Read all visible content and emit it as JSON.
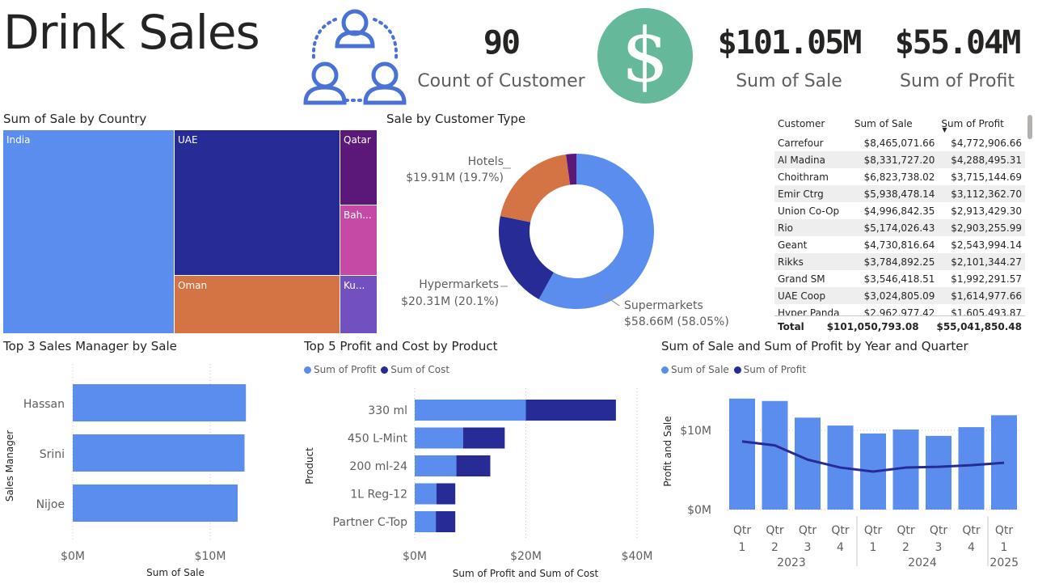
{
  "header": {
    "title": "Drink Sales",
    "customers_icon": "users-group-icon",
    "dollar_icon": "dollar-icon",
    "kpis": [
      {
        "value": "90",
        "label": "Count of Customer"
      },
      {
        "value": "$101.05M",
        "label": "Sum of Sale"
      },
      {
        "value": "$55.04M",
        "label": "Sum of Profit"
      }
    ],
    "dollar_symbol": "$"
  },
  "colors": {
    "blue": "#5b8def",
    "navy": "#262b96",
    "orange": "#d47444",
    "purple": "#5c1878",
    "pink": "#c54aa5",
    "violet": "#7350c0",
    "green": "#66b89a",
    "icon_blue": "#4a72d6"
  },
  "treemap": {
    "title": "Sum of Sale by Country",
    "cells": [
      {
        "label": "India",
        "color": "#5b8def"
      },
      {
        "label": "UAE",
        "color": "#262b96"
      },
      {
        "label": "Qatar",
        "color": "#5c1878"
      },
      {
        "label": "Bah...",
        "color": "#c54aa5"
      },
      {
        "label": "Oman",
        "color": "#d47444"
      },
      {
        "label": "Ku...",
        "color": "#7350c0"
      }
    ]
  },
  "donut_labels": {
    "hotels": {
      "name": "Hotels",
      "value": "$19.91M (19.7%)"
    },
    "hyper": {
      "name": "Hypermarkets",
      "value": "$20.31M (20.1%)"
    },
    "super": {
      "name": "Supermarkets",
      "value": "$58.66M (58.05%)"
    }
  },
  "table": {
    "headers": [
      "Customer",
      "Sum of Sale",
      "Sum of Profit"
    ],
    "rows": [
      [
        "Carrefour",
        "$8,465,071.66",
        "$4,772,906.66"
      ],
      [
        "Al Madina",
        "$8,331,727.20",
        "$4,288,495.31"
      ],
      [
        "Choithram",
        "$6,823,738.02",
        "$3,715,144.69"
      ],
      [
        "Emir Ctrg",
        "$5,938,478.14",
        "$3,112,362.70"
      ],
      [
        "Union Co-Op",
        "$4,996,842.35",
        "$2,913,429.30"
      ],
      [
        "Rio",
        "$5,174,026.43",
        "$2,903,255.99"
      ],
      [
        "Geant",
        "$4,730,816.64",
        "$2,543,994.14"
      ],
      [
        "Rikks",
        "$3,784,892.25",
        "$2,101,344.27"
      ],
      [
        "Grand SM",
        "$3,546,418.51",
        "$1,992,291.57"
      ],
      [
        "UAE Coop",
        "$3,024,805.09",
        "$1,614,977.66"
      ],
      [
        "Hyper Panda",
        "$2,962,977.42",
        "$1,605,493.87"
      ]
    ],
    "total": [
      "Total",
      "$101,050,793.08",
      "$55,041,850.48"
    ],
    "sort_icon": "sort-descending-icon"
  },
  "chart_data": [
    {
      "type": "treemap",
      "title": "Sum of Sale by Country",
      "categories": [
        "India",
        "UAE",
        "Qatar",
        "Bah...",
        "Oman",
        "Ku..."
      ]
    },
    {
      "type": "pie",
      "title": "Sale by Customer Type",
      "categories": [
        "Supermarkets",
        "Hypermarkets",
        "Hotels",
        ""
      ],
      "values": [
        58.66,
        20.31,
        19.91,
        2.17
      ],
      "colors": [
        "#5b8def",
        "#262b96",
        "#d47444",
        "#5c1878"
      ]
    },
    {
      "type": "bar",
      "title": "Top 3 Sales Manager by Sale",
      "categories": [
        "Hassan",
        "Srini",
        "Nijoe"
      ],
      "values": [
        12.6,
        12.5,
        12.0
      ],
      "xlabel": "Sum of Sale",
      "ylabel": "Sales Manager",
      "ticks": [
        "$0M",
        "$10M"
      ],
      "xlim": [
        0,
        15
      ]
    },
    {
      "type": "bar",
      "title": "Top 5 Profit and Cost by Product",
      "categories": [
        "330 ml",
        "450 L-Mint",
        "200 ml-24",
        "1L Reg-12",
        "Partner C-Top"
      ],
      "series": [
        {
          "name": "Sum of Profit",
          "values": [
            20,
            8.7,
            7.5,
            3.9,
            3.8
          ],
          "color": "#5b8def"
        },
        {
          "name": "Sum of Cost",
          "values": [
            16.2,
            7.5,
            6.1,
            3.4,
            3.5
          ],
          "color": "#262b96"
        }
      ],
      "xlabel": "Sum of Profit and Sum of Cost",
      "ylabel": "Product",
      "ticks": [
        "$0M",
        "$20M",
        "$40M"
      ],
      "xlim": [
        0,
        40
      ]
    },
    {
      "type": "bar",
      "title": "Sum of Sale and Sum of Profit by Year and Quarter",
      "categories": [
        "Qtr 1",
        "Qtr 2",
        "Qtr 3",
        "Qtr 4",
        "Qtr 1",
        "Qtr 2",
        "Qtr 3",
        "Qtr 4",
        "Qtr 1"
      ],
      "years": [
        {
          "label": "2023",
          "span": 4
        },
        {
          "label": "2024",
          "span": 4
        },
        {
          "label": "2025",
          "span": 1
        }
      ],
      "series": [
        {
          "name": "Sum of Sale",
          "type": "bar",
          "values": [
            14.0,
            13.7,
            11.6,
            10.6,
            9.6,
            10.1,
            9.3,
            10.4,
            11.9
          ],
          "color": "#5b8def"
        },
        {
          "name": "Sum of Profit",
          "type": "line",
          "values": [
            8.6,
            8.1,
            6.3,
            5.3,
            4.8,
            5.3,
            5.4,
            5.6,
            5.9
          ],
          "color": "#262b96"
        }
      ],
      "ylabel": "Profit and Sale",
      "ticks": [
        "$0M",
        "$10M"
      ],
      "ylim": [
        0,
        15
      ]
    }
  ]
}
